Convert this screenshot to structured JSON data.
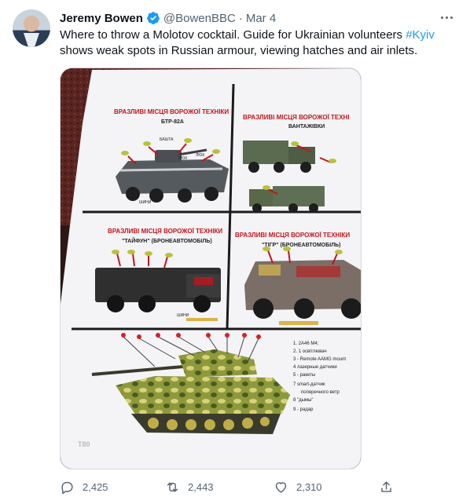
{
  "tweet": {
    "author_name": "Jeremy Bowen",
    "handle": "@BowenBBC",
    "separator": "·",
    "time": "Mar 4",
    "text_part1": "Where to throw a Molotov cocktail. Guide for Ukrainian volunteers ",
    "hashtag": "#Kyiv",
    "text_part2": " shows weak spots in Russian armour, viewing hatches and air inlets.",
    "verified_color": "#1d9bf0"
  },
  "poster": {
    "panel1_title": "ВРАЗЛИВІ МІСЦЯ ВОРОЖОЇ ТЕХНІКИ",
    "panel1_sub": "БТР-82А",
    "panel2_title": "ВРАЗЛИВІ МІСЦЯ ВОРОЖОЇ ТЕХНІ",
    "panel2_sub": "ВАНТАЖІВКИ",
    "panel3_title": "ВРАЗЛИВІ МІСЦЯ ВОРОЖОЇ ТЕХНІКИ",
    "panel3_sub": "\"ТАЙФУН\" (БРОНЕАВТОМОБІЛЬ)",
    "panel4_title": "ВРАЗЛИВІ МІСЦЯ ВОРОЖОЇ ТЕХНІКИ",
    "panel4_sub": "\"ТІГР\" (БРОНЕАВТОМОБІЛЬ)",
    "label_bashta": "БАШТА",
    "label_lyuk": "ЛЮК",
    "label_lyuk2": "ЛЮК",
    "label_shyny": "ШИНИ",
    "label_shyny2": "ШИНИ",
    "legend": [
      "1. 2А46 М4;",
      "2. 1 освітлювач",
      "3 - Remote AAMG mount",
      "4 лазерные датчики",
      "5 - ракеты",
      "7  smart-датчик",
      "поперечного ветр",
      "8  \"дымы\"",
      "9 - радар"
    ],
    "tank_label": "T80"
  },
  "actions": {
    "replies": "2,425",
    "retweets": "2,443",
    "likes": "2,310"
  }
}
